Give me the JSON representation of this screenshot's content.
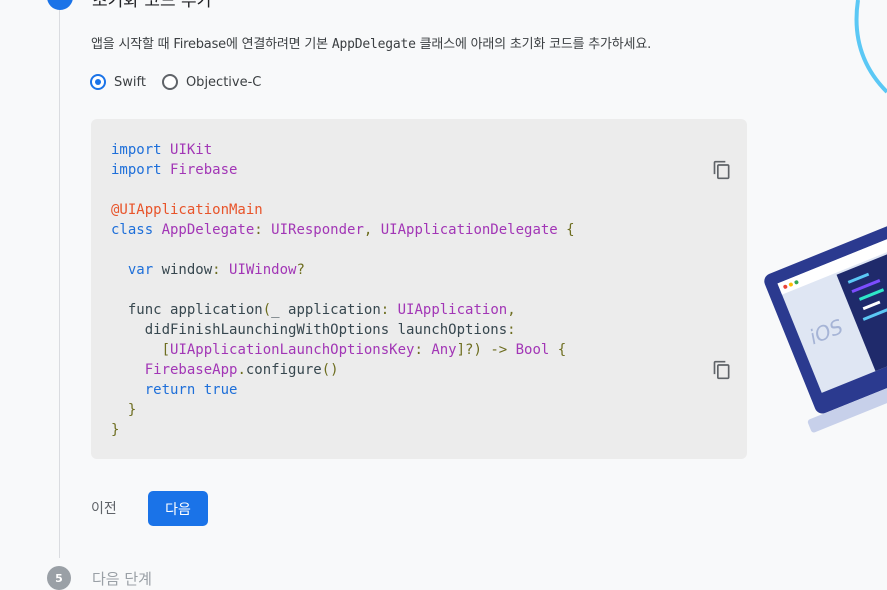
{
  "step_header": {
    "title": "초기화 코드 추가"
  },
  "instructions": {
    "prefix": "앱을 시작할 때 Firebase에 연결하려면 기본 ",
    "class_name": "AppDelegate",
    "suffix": " 클래스에 아래의 초기화 코드를 추가하세요."
  },
  "language_options": [
    {
      "label": "Swift",
      "selected": true
    },
    {
      "label": "Objective-C",
      "selected": false
    }
  ],
  "code": {
    "lines": [
      [
        {
          "t": "import ",
          "c": "kw"
        },
        {
          "t": "UIKit",
          "c": "ty"
        }
      ],
      [
        {
          "t": "import ",
          "c": "kw"
        },
        {
          "t": "Firebase",
          "c": "ty"
        }
      ],
      [],
      [
        {
          "t": "@UIApplicationMain",
          "c": "at"
        }
      ],
      [
        {
          "t": "class ",
          "c": "kw"
        },
        {
          "t": "AppDelegate",
          "c": "ty"
        },
        {
          "t": ": ",
          "c": "pu"
        },
        {
          "t": "UIResponder",
          "c": "ty"
        },
        {
          "t": ", ",
          "c": "pu"
        },
        {
          "t": "UIApplicationDelegate",
          "c": "ty"
        },
        {
          "t": " {",
          "c": "pu"
        }
      ],
      [],
      [
        {
          "t": "  var ",
          "c": "kw"
        },
        {
          "t": "window",
          "c": ""
        },
        {
          "t": ": ",
          "c": "pu"
        },
        {
          "t": "UIWindow",
          "c": "ty"
        },
        {
          "t": "?",
          "c": "pu"
        }
      ],
      [],
      [
        {
          "t": "  func ",
          "c": ""
        },
        {
          "t": "application",
          "c": ""
        },
        {
          "t": "(",
          "c": "pu"
        },
        {
          "t": "_ application",
          "c": ""
        },
        {
          "t": ": ",
          "c": "pu"
        },
        {
          "t": "UIApplication",
          "c": "ty"
        },
        {
          "t": ",",
          "c": "pu"
        }
      ],
      [
        {
          "t": "    didFinishLaunchingWithOptions launchOptions",
          "c": ""
        },
        {
          "t": ":",
          "c": "pu"
        }
      ],
      [
        {
          "t": "      ",
          "c": ""
        },
        {
          "t": "[",
          "c": "pu"
        },
        {
          "t": "UIApplicationLaunchOptionsKey",
          "c": "ty"
        },
        {
          "t": ": ",
          "c": "pu"
        },
        {
          "t": "Any",
          "c": "ty"
        },
        {
          "t": "]?) -> ",
          "c": "pu"
        },
        {
          "t": "Bool",
          "c": "ty"
        },
        {
          "t": " {",
          "c": "pu"
        }
      ],
      [
        {
          "t": "    ",
          "c": ""
        },
        {
          "t": "FirebaseApp",
          "c": "ty"
        },
        {
          "t": ".",
          "c": "pu"
        },
        {
          "t": "configure",
          "c": ""
        },
        {
          "t": "()",
          "c": "pu"
        }
      ],
      [
        {
          "t": "    return ",
          "c": "kw"
        },
        {
          "t": "true",
          "c": "kw"
        }
      ],
      [
        {
          "t": "  }",
          "c": "pu"
        }
      ],
      [
        {
          "t": "}",
          "c": "pu"
        }
      ]
    ]
  },
  "buttons": {
    "previous": "이전",
    "next": "다음"
  },
  "next_step": {
    "number": "5",
    "label": "다음 단계"
  },
  "illustration": {
    "badge": "iOS"
  },
  "colors": {
    "primary": "#1a73e8",
    "code_bg": "#ececec",
    "keyword": "#1e6fd9",
    "type": "#a236b6",
    "attribute": "#e8542a"
  }
}
